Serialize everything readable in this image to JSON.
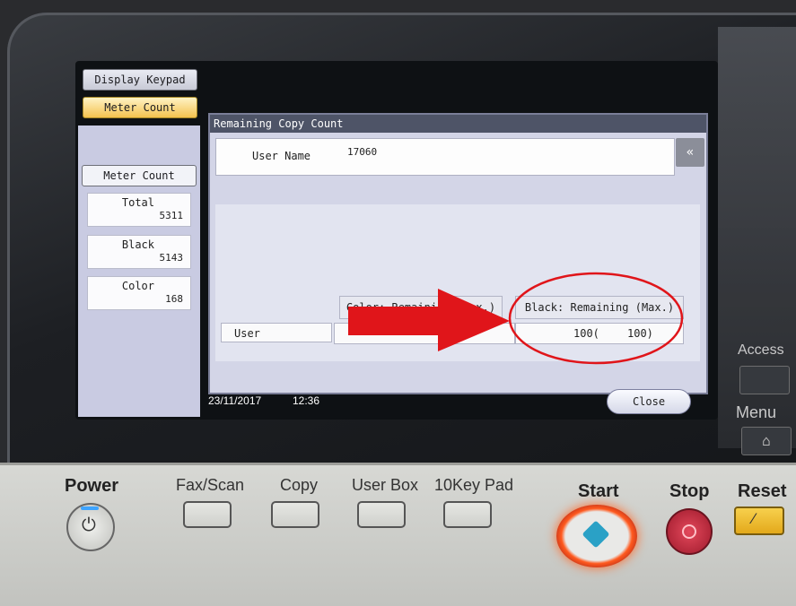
{
  "left_panel": {
    "display_keypad": "Display Keypad",
    "meter_count_tab": "Meter Count",
    "meter_count_header": "Meter Count",
    "total_label": "Total",
    "total_value": "5311",
    "black_label": "Black",
    "black_value": "5143",
    "color_label": "Color",
    "color_value": "168"
  },
  "dialog": {
    "title": "Remaining Copy Count",
    "user_name_label": "User Name",
    "user_name_value": "17060",
    "back_icon": "«",
    "color_remaining_header": "Color: Remaining (Max.)",
    "black_remaining_header": "Black: Remaining (Max.)",
    "row_label": "User",
    "black_remaining": "100(",
    "black_max": "100)"
  },
  "status": {
    "date": "23/11/2017",
    "time": "12:36",
    "close_button": "Close"
  },
  "side_panel": {
    "access_label": "Access",
    "menu_label": "Menu"
  },
  "keypad": {
    "power": "Power",
    "fax_scan": "Fax/Scan",
    "copy": "Copy",
    "user_box": "User Box",
    "tenkey": "10Key Pad",
    "start": "Start",
    "stop": "Stop",
    "reset": "Reset"
  },
  "colors": {
    "annotation_red": "#e0151a",
    "start_orange": "#ff5a1f",
    "start_blue": "#2aa1c6"
  }
}
